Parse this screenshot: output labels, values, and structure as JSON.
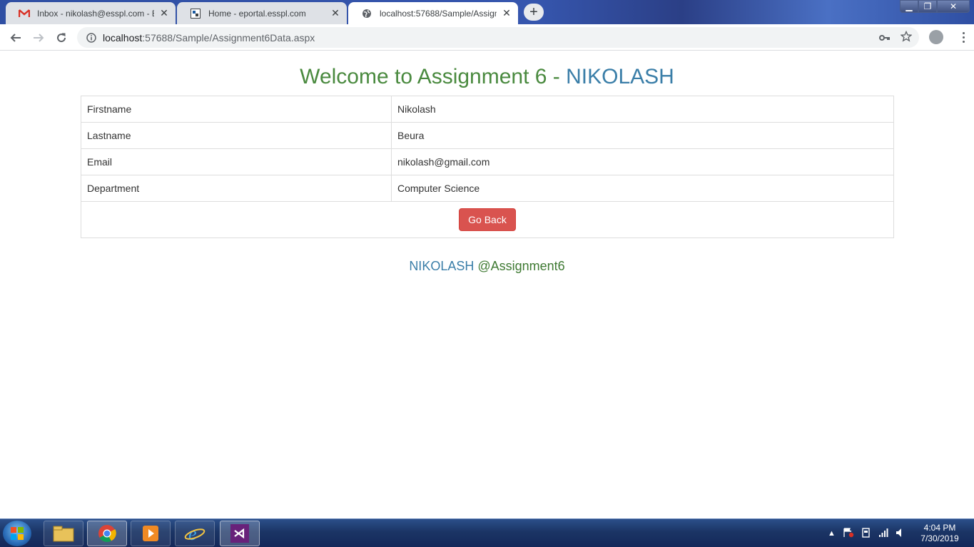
{
  "browser": {
    "tabs": [
      {
        "title": "Inbox - nikolash@esspl.com - ESS",
        "icon": "gmail-icon"
      },
      {
        "title": "Home - eportal.esspl.com",
        "icon": "eportal-icon"
      },
      {
        "title": "localhost:57688/Sample/Assignm",
        "icon": "globe-icon"
      }
    ],
    "url_host": "localhost",
    "url_path": ":57688/Sample/Assignment6Data.aspx"
  },
  "page": {
    "heading_prefix": "Welcome to Assignment 6 - ",
    "heading_name": "NIKOLASH",
    "rows": [
      {
        "label": "Firstname",
        "value": "Nikolash"
      },
      {
        "label": "Lastname",
        "value": "Beura"
      },
      {
        "label": "Email",
        "value": "nikolash@gmail.com"
      },
      {
        "label": "Department",
        "value": "Computer Science"
      }
    ],
    "go_back_label": "Go Back",
    "footer_name": "NIKOLASH",
    "footer_tag": " @Assignment6"
  },
  "taskbar": {
    "time": "4:04 PM",
    "date": "7/30/2019"
  },
  "colors": {
    "heading_green": "#4a8a3f",
    "heading_blue": "#3a7ea8",
    "button_red": "#d9534f"
  }
}
